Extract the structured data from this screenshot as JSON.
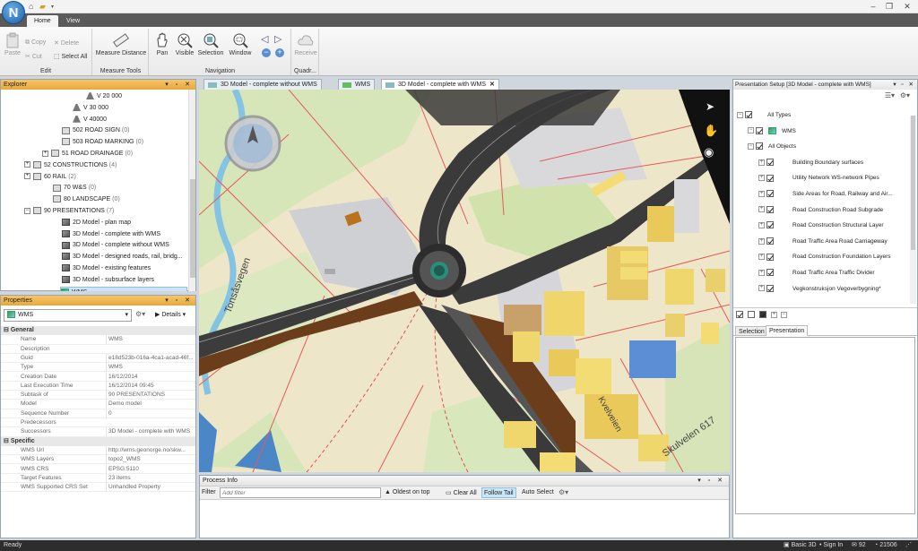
{
  "titlebar": {
    "logo": "N",
    "quick_access": [
      "house-icon",
      "folder-icon",
      "chevron-down-icon"
    ],
    "window_controls": [
      "minimize",
      "restore",
      "close"
    ]
  },
  "ribbon": {
    "tabs": [
      {
        "label": "Home",
        "active": true
      },
      {
        "label": "View",
        "active": false
      }
    ],
    "groups": [
      {
        "label": "Edit",
        "buttons": [
          {
            "label": "Paste",
            "enabled": false
          },
          {
            "label": "Copy",
            "enabled": false
          },
          {
            "label": "Cut",
            "enabled": false
          },
          {
            "label": "Delete",
            "enabled": false
          },
          {
            "label": "Select All",
            "enabled": true
          }
        ]
      },
      {
        "label": "Measure Tools",
        "buttons": [
          {
            "label": "Measure Distance",
            "enabled": true
          }
        ]
      },
      {
        "label": "Navigation",
        "buttons": [
          {
            "label": "Pan"
          },
          {
            "label": "Visible"
          },
          {
            "label": "Selection"
          },
          {
            "label": "Window"
          }
        ]
      },
      {
        "label": "Quadr...",
        "buttons": [
          {
            "label": "Receive",
            "enabled": false
          }
        ]
      }
    ]
  },
  "explorer": {
    "title": "Explorer",
    "items": [
      {
        "label": "V 20 000",
        "count": ""
      },
      {
        "label": "V 30 000",
        "count": ""
      },
      {
        "label": "V 40000",
        "count": ""
      },
      {
        "label": "502 ROAD SIGN",
        "count": "(0)"
      },
      {
        "label": "503 ROAD MARKING",
        "count": "(0)"
      },
      {
        "label": "51 ROAD DRAINAGE",
        "count": "(0)"
      },
      {
        "label": "52 CONSTRUCTIONS",
        "count": "(4)"
      },
      {
        "label": "60 RAIL",
        "count": "(2)"
      },
      {
        "label": "70 W&S",
        "count": "(0)"
      },
      {
        "label": "80 LANDSCAPE",
        "count": "(0)"
      },
      {
        "label": "90 PRESENTATIONS",
        "count": "(7)"
      },
      {
        "label": "2D Model - plan map",
        "count": ""
      },
      {
        "label": "3D Model - complete with WMS",
        "count": ""
      },
      {
        "label": "3D Model - complete without WMS",
        "count": ""
      },
      {
        "label": "3D Model - designed roads, rail, bridg...",
        "count": ""
      },
      {
        "label": "3D Model - existing features",
        "count": ""
      },
      {
        "label": "3D Model - subsurface layers",
        "count": ""
      },
      {
        "label": "WMS",
        "count": ""
      }
    ]
  },
  "properties": {
    "title": "Properties",
    "selected": "WMS",
    "details_label": "Details",
    "general_label": "General",
    "specific_label": "Specific",
    "general": [
      {
        "k": "Name",
        "v": "WMS"
      },
      {
        "k": "Description",
        "v": ""
      },
      {
        "k": "Guid",
        "v": "e18d523b-016a-4ca1-acad-46f..."
      },
      {
        "k": "Type",
        "v": "WMS"
      },
      {
        "k": "Creation Date",
        "v": "16/12/2014"
      },
      {
        "k": "Last Execution Time",
        "v": "16/12/2014 09:45"
      },
      {
        "k": "Subtask of",
        "v": "90 PRESENTATIONS"
      },
      {
        "k": "Model",
        "v": "Demo model"
      },
      {
        "k": "Sequence Number",
        "v": "0"
      },
      {
        "k": "Predecessors",
        "v": ""
      },
      {
        "k": "Successors",
        "v": "3D Model - complete with WMS"
      }
    ],
    "specific": [
      {
        "k": "WMS Url",
        "v": "http://wms.geonorge.no/skw..."
      },
      {
        "k": "WMS Layers",
        "v": "topo2_WMS"
      },
      {
        "k": "WMS CRS",
        "v": "EPSG:5110"
      },
      {
        "k": "Target Features",
        "v": "23 items"
      },
      {
        "k": "WMS Supported CRS Set",
        "v": "Unhandled Property"
      }
    ]
  },
  "document_tabs": [
    {
      "label": "3D Model - complete without WMS",
      "active": false
    },
    {
      "label": "WMS",
      "active": false
    },
    {
      "label": "3D Model - complete with WMS",
      "active": true
    }
  ],
  "map": {
    "labels": [
      "Tonsåsvegen",
      "Skulvelen 617",
      "Kvelveien"
    ],
    "nav_icons": [
      "pointer-icon",
      "hand-icon",
      "orbit-icon"
    ]
  },
  "process_info": {
    "title": "Process Info",
    "filter_label": "Filter",
    "filter_placeholder": "Add filter",
    "oldest_on_top": "Oldest on top",
    "clear_all": "Clear All",
    "follow_tail": "Follow Tail",
    "auto_select": "Auto Select"
  },
  "presentation": {
    "title": "Presentation Setup [3D Model - complete with WMS]",
    "items": [
      {
        "label": "All Types",
        "level": 0
      },
      {
        "label": "WMS",
        "level": 1
      },
      {
        "label": "All Objects",
        "level": 1
      },
      {
        "label": "Building Boundary surfaces",
        "level": 2
      },
      {
        "label": "Utility Network WS-network Pipes",
        "level": 2
      },
      {
        "label": "Side Areas for Road, Railway and Air...",
        "level": 2
      },
      {
        "label": "Road Construction Road Subgrade",
        "level": 2
      },
      {
        "label": "Road Construction Structural Layer",
        "level": 2
      },
      {
        "label": "Road Traffic Area Road Carriageway",
        "level": 2
      },
      {
        "label": "Road Construction Foundation Layers",
        "level": 2
      },
      {
        "label": "Road Traffic Area Traffic Divider",
        "level": 2
      },
      {
        "label": "Vegkonstruksjon Vegoverbygning*",
        "level": 2
      }
    ],
    "tabs": [
      {
        "label": "Selection",
        "active": false
      },
      {
        "label": "Presentation",
        "active": true
      }
    ]
  },
  "status": {
    "left": "Ready",
    "mode": "Basic 3D",
    "sign_in": "Sign In",
    "num1": "92",
    "num2": "21506"
  }
}
